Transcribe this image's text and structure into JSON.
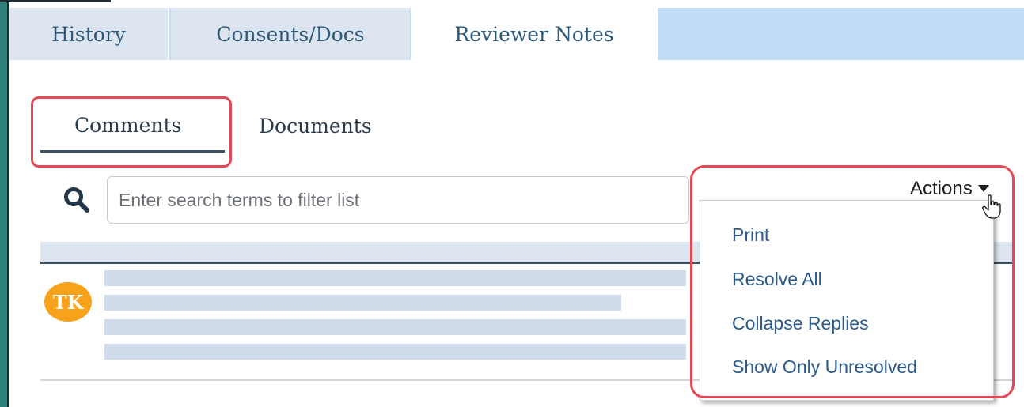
{
  "top_tabs": [
    {
      "label": "History"
    },
    {
      "label": "Consents/Docs"
    },
    {
      "label": "Reviewer Notes",
      "active": true
    }
  ],
  "sub_tabs": [
    {
      "label": "Comments",
      "active": true
    },
    {
      "label": "Documents"
    }
  ],
  "search": {
    "placeholder": "Enter search terms to filter list",
    "value": ""
  },
  "actions": {
    "label": "Actions",
    "menu_items": [
      "Print",
      "Resolve All",
      "Collapse Replies",
      "Show Only Unresolved"
    ]
  },
  "comment": {
    "avatar_initials": "TK"
  },
  "colors": {
    "highlight": "#e44854",
    "avatar": "#f7a21a",
    "link": "#2c5a8a",
    "tab_bar": "#c1dcf5"
  },
  "icons": [
    "search-icon",
    "caret-down-icon",
    "hand-pointer-icon"
  ]
}
